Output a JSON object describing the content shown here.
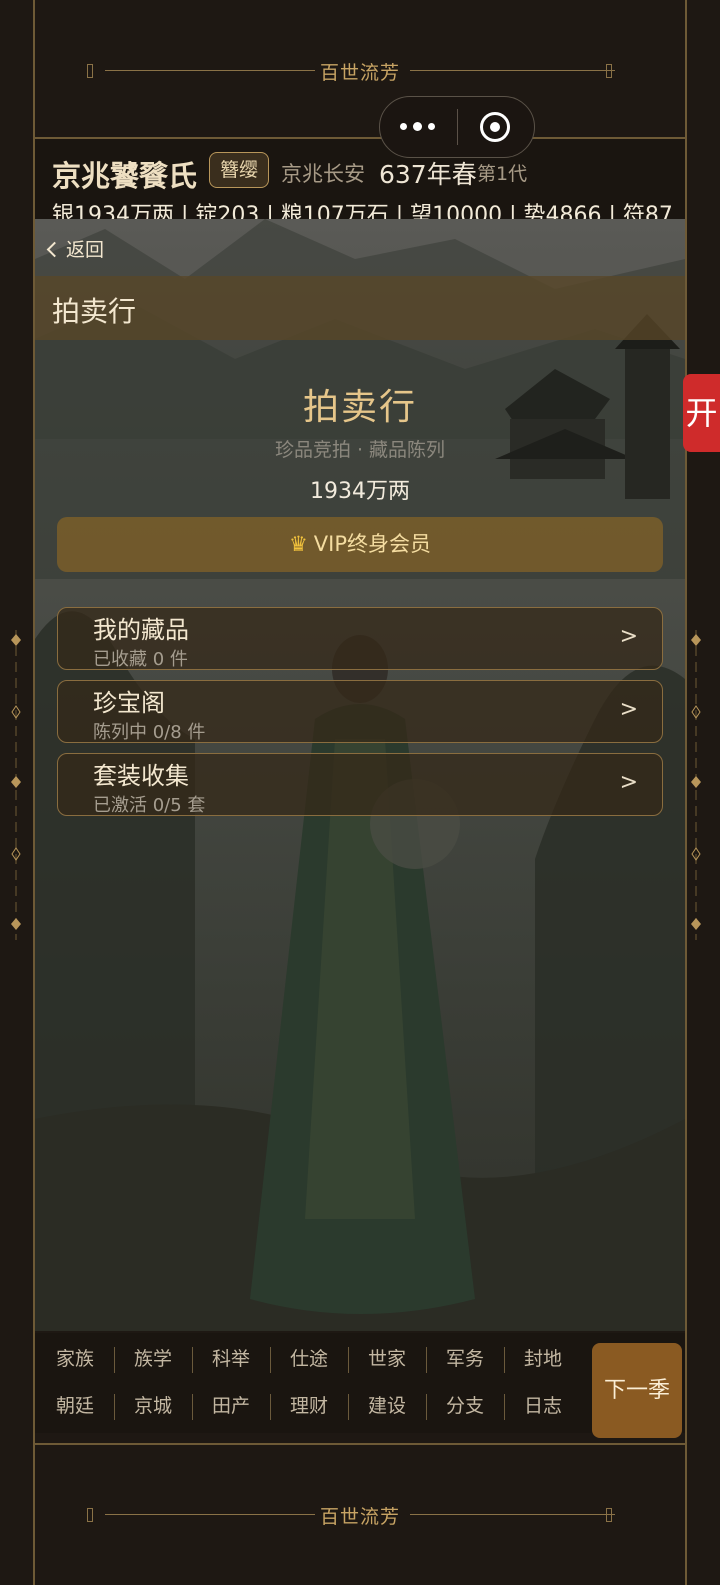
{
  "banner": {
    "title": "百世流芳"
  },
  "capsule": {
    "more_icon": "more-dots-icon",
    "close_icon": "target-circle-icon"
  },
  "header": {
    "family_name": "京兆饕餮氏",
    "title_badge": "簪缨",
    "location": "京兆长安",
    "year": "637年春",
    "generation": "第1代",
    "stats": "银1934万两 | 锭203 | 粮107万石 | 望10000 | 势4866 | 符87"
  },
  "page": {
    "back_label": "返回",
    "title": "拍卖行"
  },
  "hero": {
    "title": "拍卖行",
    "subtitle": "珍品竞拍 · 藏品陈列",
    "money": "1934万两"
  },
  "vip": {
    "icon": "crown-icon",
    "label": "VIP终身会员"
  },
  "cards": [
    {
      "name": "我的藏品",
      "desc": "已收藏 0 件",
      "arrow": ">"
    },
    {
      "name": "珍宝阁",
      "desc": "陈列中 0/8 件",
      "arrow": ">"
    },
    {
      "name": "套装收集",
      "desc": "已激活 0/5 套",
      "arrow": ">"
    }
  ],
  "side_tab": {
    "label": "开"
  },
  "nav": {
    "row1": [
      "家族",
      "族学",
      "科举",
      "仕途",
      "世家",
      "军务",
      "封地"
    ],
    "row2": [
      "朝廷",
      "京城",
      "田产",
      "理财",
      "建设",
      "分支",
      "日志"
    ],
    "next_season": "下一季"
  },
  "colors": {
    "accent_gold": "#c8a464",
    "next_button": "#8a5a22",
    "side_tab": "#cf2b2b"
  }
}
